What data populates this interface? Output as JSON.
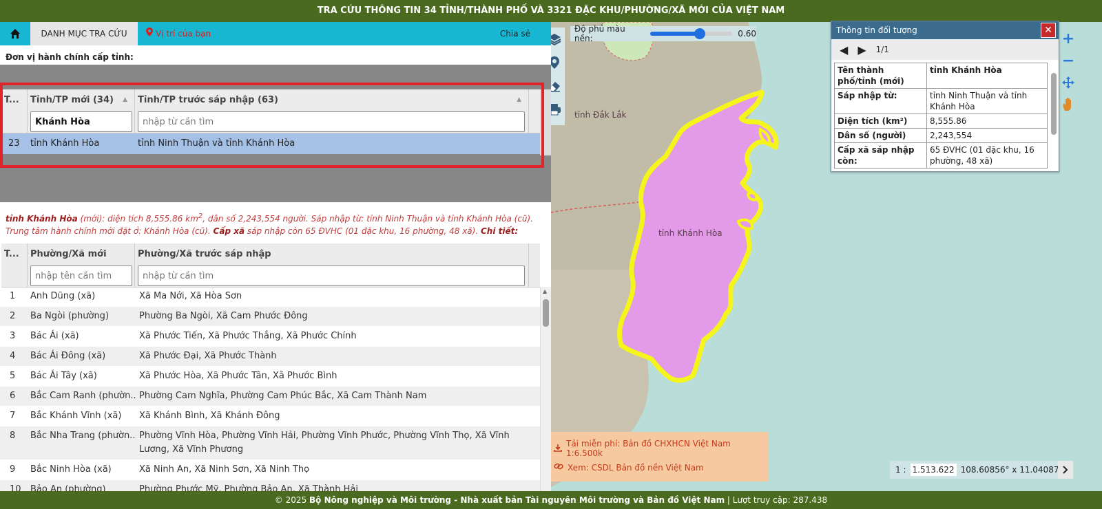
{
  "header": {
    "title": "TRA CỨU THÔNG TIN 34 TỈNH/THÀNH PHỐ VÀ 3321 ĐẶC KHU/PHƯỜNG/XÃ MỚI CỦA VIỆT NAM"
  },
  "nav": {
    "tab_label": "DANH MỤC TRA CỨU",
    "location_label": "Vị trí của bạn",
    "share_label": "Chia sẻ"
  },
  "province": {
    "section_title": "Đơn vị hành chính cấp tỉnh:",
    "col_index": "T...",
    "col_new": "Tỉnh/TP mới (34)",
    "col_old": "Tỉnh/TP trước sáp nhập (63)",
    "search_new_value": "Khánh Hòa",
    "search_old_placeholder": "nhập từ cần tìm",
    "selected_row": {
      "index": "23",
      "new": "tỉnh Khánh Hòa",
      "old": "tỉnh Ninh Thuận và tỉnh Khánh Hòa"
    }
  },
  "summary": {
    "name": "tỉnh Khánh Hòa",
    "text1": " (mới): diện tích 8,555.86 km",
    "sup": "2",
    "text2": ", dân số 2,243,554 người. Sáp nhập từ: tỉnh Ninh Thuận và tỉnh Khánh Hòa (cũ). Trung tâm hành chính mới đặt ở: Khánh Hòa (cũ). ",
    "label_cap_xa": "Cấp xã",
    "text3": " sáp nhập còn 65 ĐVHC (01 đặc khu, 16 phường, 48 xã). ",
    "label_detail": "Chi tiết:"
  },
  "wards": {
    "col_index": "T...",
    "col_new": "Phường/Xã mới",
    "col_old": "Phường/Xã trước sáp nhập",
    "search_new_placeholder": "nhập tên cần tìm",
    "search_old_placeholder": "nhập từ cần tìm",
    "rows": [
      {
        "i": "1",
        "new": "Anh Dũng (xã)",
        "old": "Xã Ma Nới, Xã Hòa Sơn"
      },
      {
        "i": "2",
        "new": "Ba Ngòi (phường)",
        "old": "Phường Ba Ngòi, Xã Cam Phước Đông"
      },
      {
        "i": "3",
        "new": "Bác Ái (xã)",
        "old": "Xã Phước Tiến, Xã Phước Thắng, Xã Phước Chính"
      },
      {
        "i": "4",
        "new": "Bác Ái Đông (xã)",
        "old": "Xã Phước Đại, Xã Phước Thành"
      },
      {
        "i": "5",
        "new": "Bác Ái Tây (xã)",
        "old": "Xã Phước Hòa, Xã Phước Tân, Xã Phước Bình"
      },
      {
        "i": "6",
        "new": "Bắc Cam Ranh (phườn...",
        "old": "Phường Cam Nghĩa, Phường Cam Phúc Bắc, Xã Cam Thành Nam"
      },
      {
        "i": "7",
        "new": "Bắc Khánh Vĩnh (xã)",
        "old": "Xã Khánh Bình, Xã Khánh Đông"
      },
      {
        "i": "8",
        "new": "Bắc Nha Trang (phườn...",
        "old": "Phường Vĩnh Hòa, Phường Vĩnh Hải, Phường Vĩnh Phước, Phường Vĩnh Thọ, Xã Vĩnh Lương, Xã Vĩnh Phương"
      },
      {
        "i": "9",
        "new": "Bắc Ninh Hòa (xã)",
        "old": "Xã Ninh An, Xã Ninh Sơn, Xã Ninh Thọ"
      },
      {
        "i": "10",
        "new": "Bảo An (phường)",
        "old": "Phường Phước Mỹ, Phường Bảo An, Xã Thành Hải"
      }
    ]
  },
  "map": {
    "opacity_label": "Độ phủ màu nền:",
    "opacity_value": "0.60",
    "opacity_level": 0.6,
    "label_daklak": "tỉnh Đắk Lắk",
    "label_khanhhoa": "tỉnh Khánh Hòa",
    "promo_download": "Tải miễn phí: Bản đồ CHXHCN Việt Nam 1:6.500k",
    "promo_view": "Xem: CSDL Bản đồ nền Việt Nam",
    "scale_prefix": "1 :",
    "scale_value": "1.513.622",
    "coords": "108.60856° x 11.04087°",
    "icons": [
      "layers-icon",
      "pin-icon",
      "eraser-icon",
      "print-icon",
      "zoom-in-icon",
      "zoom-out-icon",
      "pan-icon",
      "hand-icon"
    ]
  },
  "info": {
    "title": "Thông tin đối tượng",
    "pager": "1/1",
    "rows": [
      {
        "k": "Tên thành phố/tỉnh (mới)",
        "v": "tỉnh Khánh Hòa"
      },
      {
        "k": "Sáp nhập từ:",
        "v": "tỉnh Ninh Thuận và tỉnh Khánh Hòa"
      },
      {
        "k": "Diện tích (km²)",
        "v": "8,555.86"
      },
      {
        "k": "Dân số (người)",
        "v": "2,243,554"
      },
      {
        "k": "Cấp xã sáp nhập còn:",
        "v": "65 ĐVHC (01 đặc khu, 16 phường, 48 xã)"
      }
    ]
  },
  "footer": {
    "copyright": "© 2025 ",
    "org": "Bộ Nông nghiệp và Môi trường - Nhà xuất bản Tài nguyên Môi trường và Bản đồ Việt Nam",
    "visits": " | Lượt truy cập: 287.438"
  },
  "colors": {
    "header_bg": "#4a6a1f",
    "nav_bg": "#17b7d3",
    "selected_row": "#a6c1e6",
    "highlight_border": "#e0242a",
    "polygon_fill": "#e39ae8",
    "polygon_stroke": "#f5f51c"
  }
}
